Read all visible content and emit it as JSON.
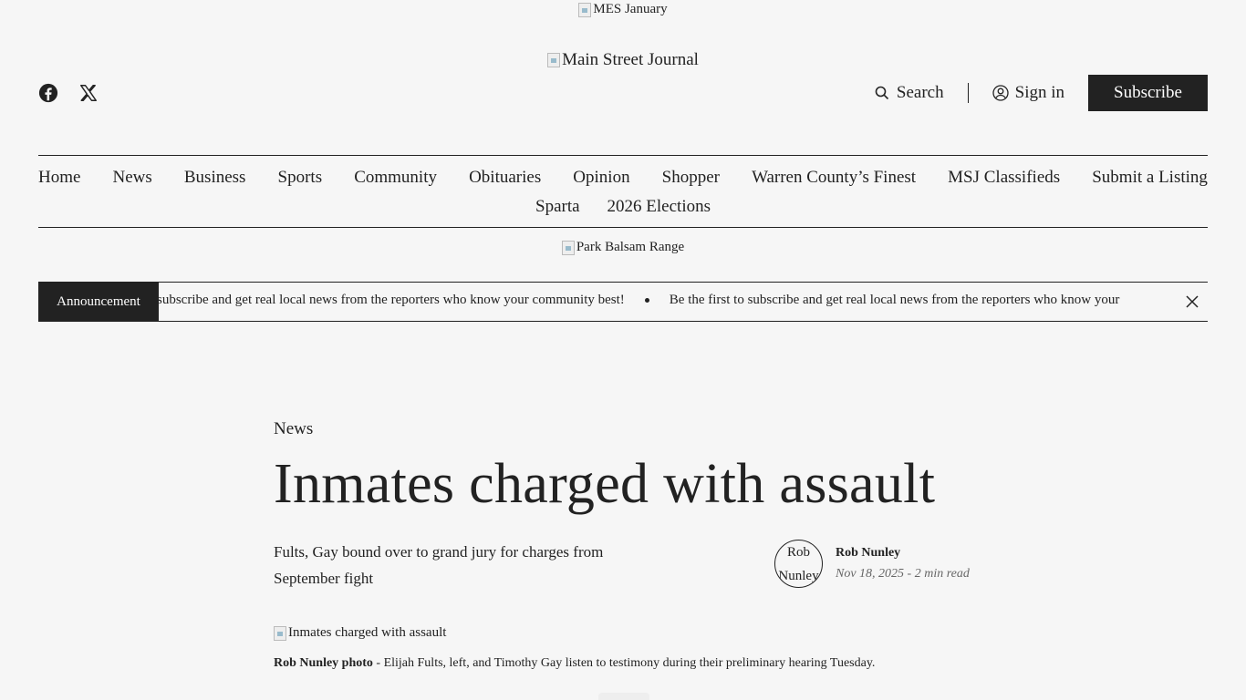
{
  "top_ad": {
    "alt": "MES January"
  },
  "masthead": {
    "logo_alt": "Main Street Journal"
  },
  "social": {
    "icons": [
      "facebook-icon",
      "x-icon"
    ]
  },
  "header_actions": {
    "search_label": "Search",
    "signin_label": "Sign in",
    "subscribe_label": "Subscribe"
  },
  "nav": {
    "row1": [
      "Home",
      "News",
      "Business",
      "Sports",
      "Community",
      "Obituaries",
      "Opinion",
      "Shopper",
      "Warren County’s Finest",
      "MSJ Classifieds",
      "Submit a Listing"
    ],
    "row2": [
      "Sparta",
      "2026 Elections"
    ]
  },
  "mid_ad": {
    "alt": "Park Balsam Range"
  },
  "announcement": {
    "label": "Announcement",
    "text_partial": "subscribe and get real local news from the reporters who know your community best!",
    "text_full": "Be the first to subscribe and get real local news from the reporters who know your"
  },
  "article": {
    "category": "News",
    "headline": "Inmates charged with assault",
    "subhead": "Fults, Gay bound over to grand jury for charges from September fight",
    "author_avatar_alt": "Rob Nunley",
    "author": "Rob Nunley",
    "meta": "Nov 18, 2025 - 2 min read",
    "photo_alt": "Inmates charged with assault",
    "caption_credit": "Rob Nunley photo",
    "caption_text": " - Elijah Fults, left, and Timothy Gay listen to testimony during their preliminary hearing Tuesday."
  }
}
